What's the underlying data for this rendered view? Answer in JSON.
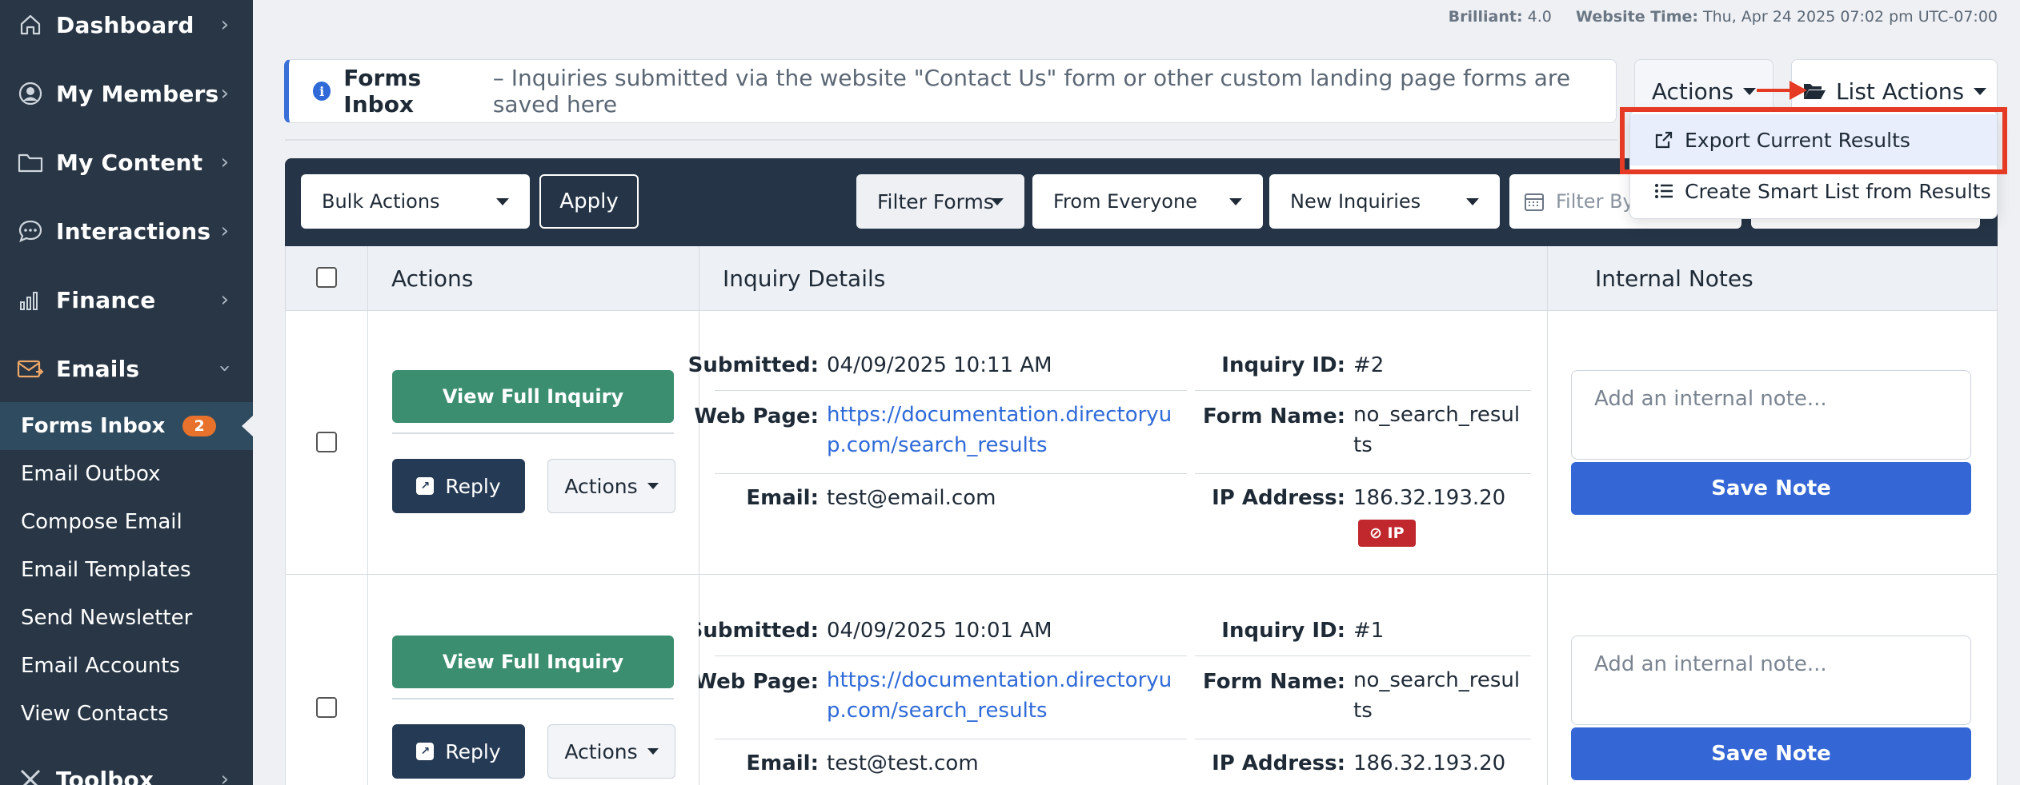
{
  "sidebar": {
    "main_items": [
      {
        "label": "Dashboard",
        "icon": "home-icon"
      },
      {
        "label": "My Members",
        "icon": "user-circle-icon"
      },
      {
        "label": "My Content",
        "icon": "folder-icon"
      },
      {
        "label": "Interactions",
        "icon": "chat-icon"
      },
      {
        "label": "Finance",
        "icon": "bar-chart-icon"
      },
      {
        "label": "Emails",
        "icon": "envelope-icon"
      }
    ],
    "email_sub_items": [
      {
        "label": "Forms Inbox",
        "active": true,
        "badge": "2"
      },
      {
        "label": "Email Outbox"
      },
      {
        "label": "Compose Email"
      },
      {
        "label": "Email Templates"
      },
      {
        "label": "Send Newsletter"
      },
      {
        "label": "Email Accounts"
      },
      {
        "label": "View Contacts"
      }
    ],
    "toolbox": {
      "label": "Toolbox",
      "icon": "tools-icon"
    }
  },
  "topbar": {
    "brilliant_label": "Brilliant:",
    "brilliant_value": "4.0",
    "website_time_label": "Website Time:",
    "website_time_value": "Thu, Apr 24 2025 07:02 pm UTC-07:00"
  },
  "banner": {
    "title": "Forms Inbox",
    "description": "– Inquiries submitted via the website \"Contact Us\" form or other custom landing page forms are saved here"
  },
  "header_buttons": {
    "actions_label": "Actions",
    "list_actions_label": "List Actions"
  },
  "list_actions_menu": {
    "items": [
      {
        "label": "Export Current Results",
        "icon": "external-link-icon",
        "highlighted": true
      },
      {
        "label": "Create Smart List from Results",
        "icon": "list-icon"
      }
    ]
  },
  "filters": {
    "bulk_actions": "Bulk Actions",
    "apply": "Apply",
    "filter_forms": "Filter Forms",
    "from_everyone": "From Everyone",
    "new_inquiries": "New Inquiries",
    "filter_by_placeholder": "Filter By"
  },
  "table": {
    "headers": {
      "actions": "Actions",
      "inquiry_details": "Inquiry Details",
      "internal_notes": "Internal Notes"
    },
    "labels": {
      "submitted": "Submitted:",
      "web_page": "Web Page:",
      "email": "Email:",
      "inquiry_id": "Inquiry ID:",
      "form_name": "Form Name:",
      "ip_address": "IP Address:"
    },
    "view_full_inquiry": "View Full Inquiry",
    "reply": "Reply",
    "row_actions": "Actions",
    "note_placeholder": "Add an internal note...",
    "save_note": "Save Note",
    "ip_badge": "IP",
    "rows": [
      {
        "submitted": "04/09/2025 10:11 AM",
        "web_page": "https://documentation.directoryup.com/search_results",
        "email": "test@email.com",
        "inquiry_id": "#2",
        "form_name": "no_search_results",
        "ip_address": "186.32.193.20"
      },
      {
        "submitted": "04/09/2025 10:01 AM",
        "web_page": "https://documentation.directoryup.com/search_results",
        "email": "test@test.com",
        "inquiry_id": "#1",
        "form_name": "no_search_results",
        "ip_address": "186.32.193.20"
      }
    ]
  },
  "colors": {
    "sidebar_bg": "#283645",
    "active_sub_bg": "#2e4b5f",
    "badge_orange": "#e8722c",
    "view_button_green": "#3b8e6f",
    "reply_button_navy": "#253a55",
    "save_button_blue": "#3466d6",
    "ip_badge_red": "#c0282d",
    "highlight_red": "#e53a24",
    "link_blue": "#2f6ad8"
  }
}
